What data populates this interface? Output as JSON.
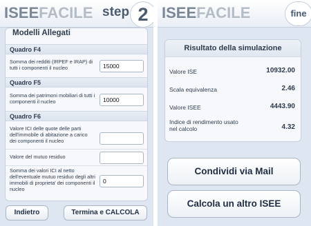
{
  "app": {
    "logo_part1": "ISEE",
    "logo_part2": "FACILE"
  },
  "left": {
    "step_label": "step",
    "step_number": "2",
    "card_title": "Modelli Allegati",
    "sections": [
      {
        "title": "Quadro F4"
      },
      {
        "title": "Quadro F5"
      },
      {
        "title": "Quadro F6"
      }
    ],
    "fields": [
      {
        "label": "Somma dei redditi (IRPEF e IRAP) di tutti i componenti il nucleo",
        "value": "15000"
      },
      {
        "label": "Somma dei patrimoni mobiliari di tutti i componenti il nucleo",
        "value": "10000"
      },
      {
        "label": "Valore ICI delle quote delle parti dell'immobile di abitazione a carico dei componenti il nucleo",
        "value": ""
      },
      {
        "label": "Valore del mutuo residuo",
        "value": ""
      },
      {
        "label": "Somma dei valori ICI al netto dell'eventuale mutuo residuo degli altri immobili di proprieta' dei componenti il nucleo",
        "value": "0"
      }
    ],
    "back_label": "Indietro",
    "calc_label": "Termina e CALCOLA"
  },
  "right": {
    "badge": "fine",
    "result_title": "Risultato della simulazione",
    "rows": [
      {
        "label": "Valore ISE",
        "value": "10932.00"
      },
      {
        "label": "Scala equivalenza",
        "value": "2.46"
      },
      {
        "label": "Valore ISEE",
        "value": "4443.90"
      },
      {
        "label": "Indice di rendimento usato nel calcolo",
        "value": "4.32"
      }
    ],
    "share_label": "Condividi via Mail",
    "new_label": "Calcola un altro ISEE"
  }
}
